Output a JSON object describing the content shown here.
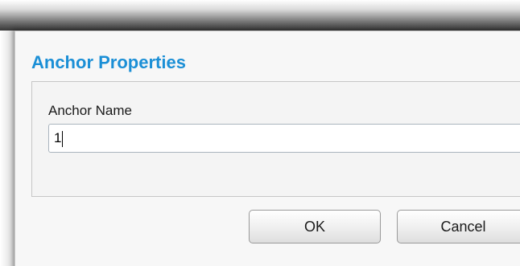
{
  "dialog": {
    "title": "Anchor Properties",
    "field": {
      "label": "Anchor Name",
      "value": "1"
    },
    "buttons": {
      "ok_label": "OK",
      "cancel_label": "Cancel"
    }
  },
  "colors": {
    "title": "#1b8fd6",
    "dialog_background": "#f7f7f7",
    "panel_border": "#c6c6c6"
  }
}
